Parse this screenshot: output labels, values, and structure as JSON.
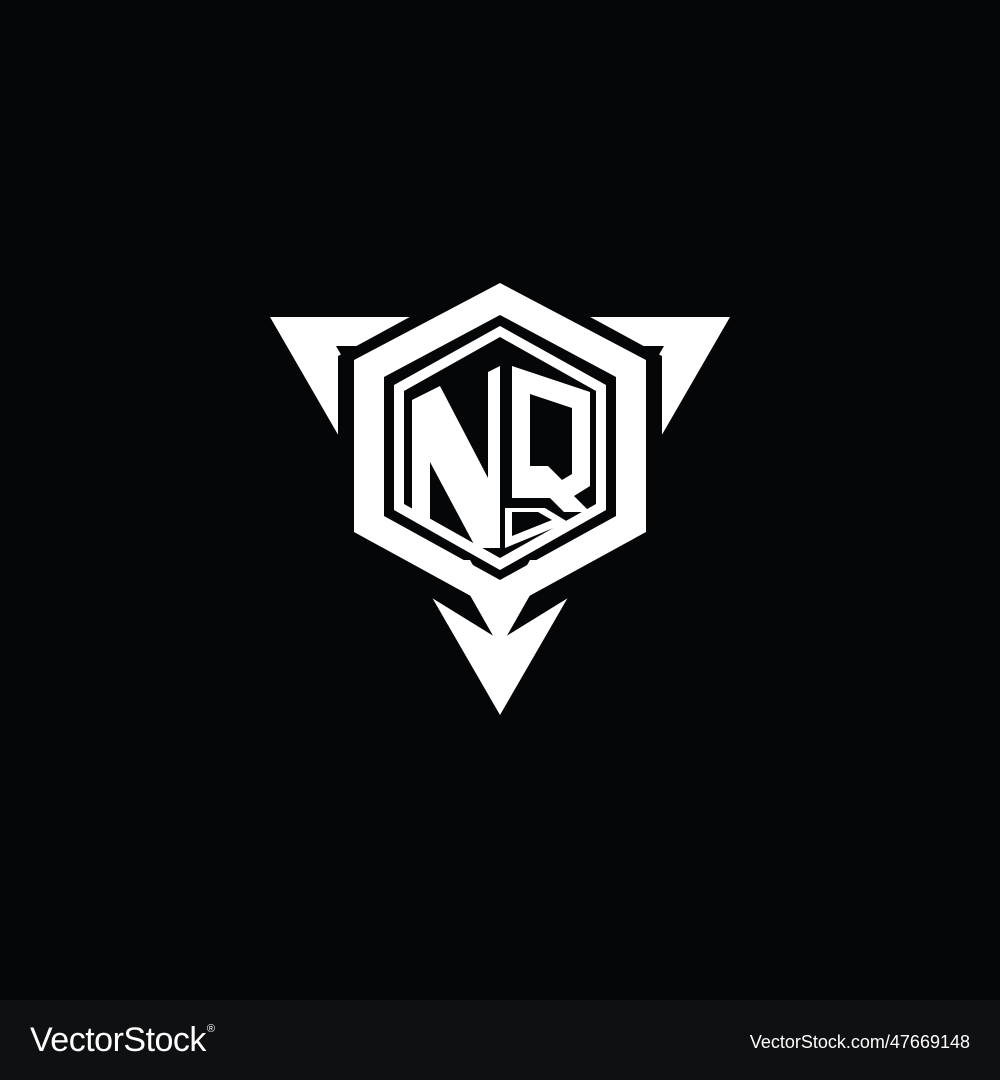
{
  "background_color": "#050608",
  "footer_color": "#0f1012",
  "logo_color": "#ffffff",
  "logo": {
    "icon": "nq-triangle-hexagon-logo",
    "monogram": "NQ"
  },
  "footer": {
    "brand": "VectorStock",
    "registered": "®",
    "image_id": "VectorStock.com/47669148"
  }
}
